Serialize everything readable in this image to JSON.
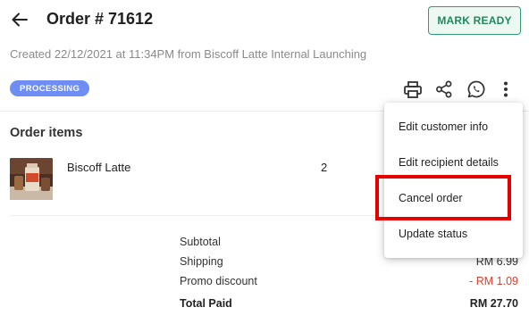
{
  "header": {
    "back_icon": "arrow-left-icon",
    "title": "Order # 71612",
    "mark_ready_label": "MARK READY"
  },
  "order_meta": {
    "created_text": "Created 22/12/2021 at 11:34PM from Biscoff Latte Internal Launching"
  },
  "status": {
    "badge_label": "PROCESSING",
    "badge_color": "#6f8ef5"
  },
  "toolbar": {
    "icons": [
      "printer-icon",
      "share-icon",
      "whatsapp-icon",
      "more-vertical-icon"
    ]
  },
  "order_items": {
    "section_title": "Order items",
    "items": [
      {
        "name": "Biscoff Latte",
        "quantity": "2",
        "thumbnail": "product-thumbnail"
      }
    ]
  },
  "summary": {
    "rows": [
      {
        "label": "Subtotal",
        "value": ""
      },
      {
        "label": "Shipping",
        "value": "RM 6.99"
      },
      {
        "label": "Promo discount",
        "value": "- RM 1.09"
      }
    ],
    "total": {
      "label": "Total Paid",
      "value": "RM 27.70"
    }
  },
  "dropdown_menu": {
    "items": [
      {
        "label": "Edit customer info"
      },
      {
        "label": "Edit recipient details"
      },
      {
        "label": "Cancel order",
        "highlighted": true
      },
      {
        "label": "Update status"
      }
    ]
  },
  "colors": {
    "accent_green": "#1d8a5e",
    "discount_red": "#d9402e",
    "highlight_red": "#e50000"
  }
}
